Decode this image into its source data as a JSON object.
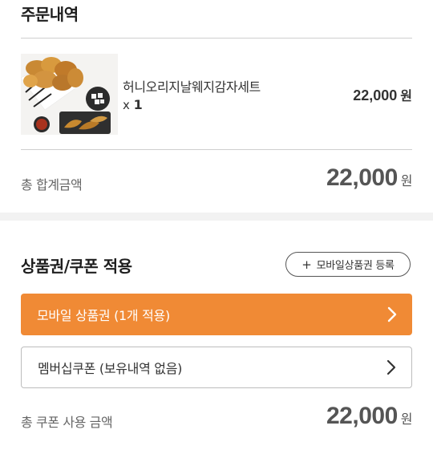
{
  "order": {
    "title": "주문내역",
    "item": {
      "name": "허니오리지날웨지감자세트",
      "qty_prefix": "x",
      "qty": "1",
      "price": "22,000",
      "price_unit": "원"
    },
    "total_label": "총 합계금액",
    "total_amount": "22,000",
    "total_unit": "원"
  },
  "coupon": {
    "title": "상품권/쿠폰 적용",
    "register_button": "모바일상품권 등록",
    "mobile_voucher_button": "모바일 상품권 (1개 적용)",
    "membership_coupon_button": "멤버십쿠폰 (보유내역 없음)",
    "used_label": "총 쿠폰 사용 금액",
    "used_amount": "22,000",
    "used_unit": "원"
  },
  "colors": {
    "accent": "#f08a35",
    "divider": "#cfcfcf",
    "band": "#f2f2f2"
  }
}
